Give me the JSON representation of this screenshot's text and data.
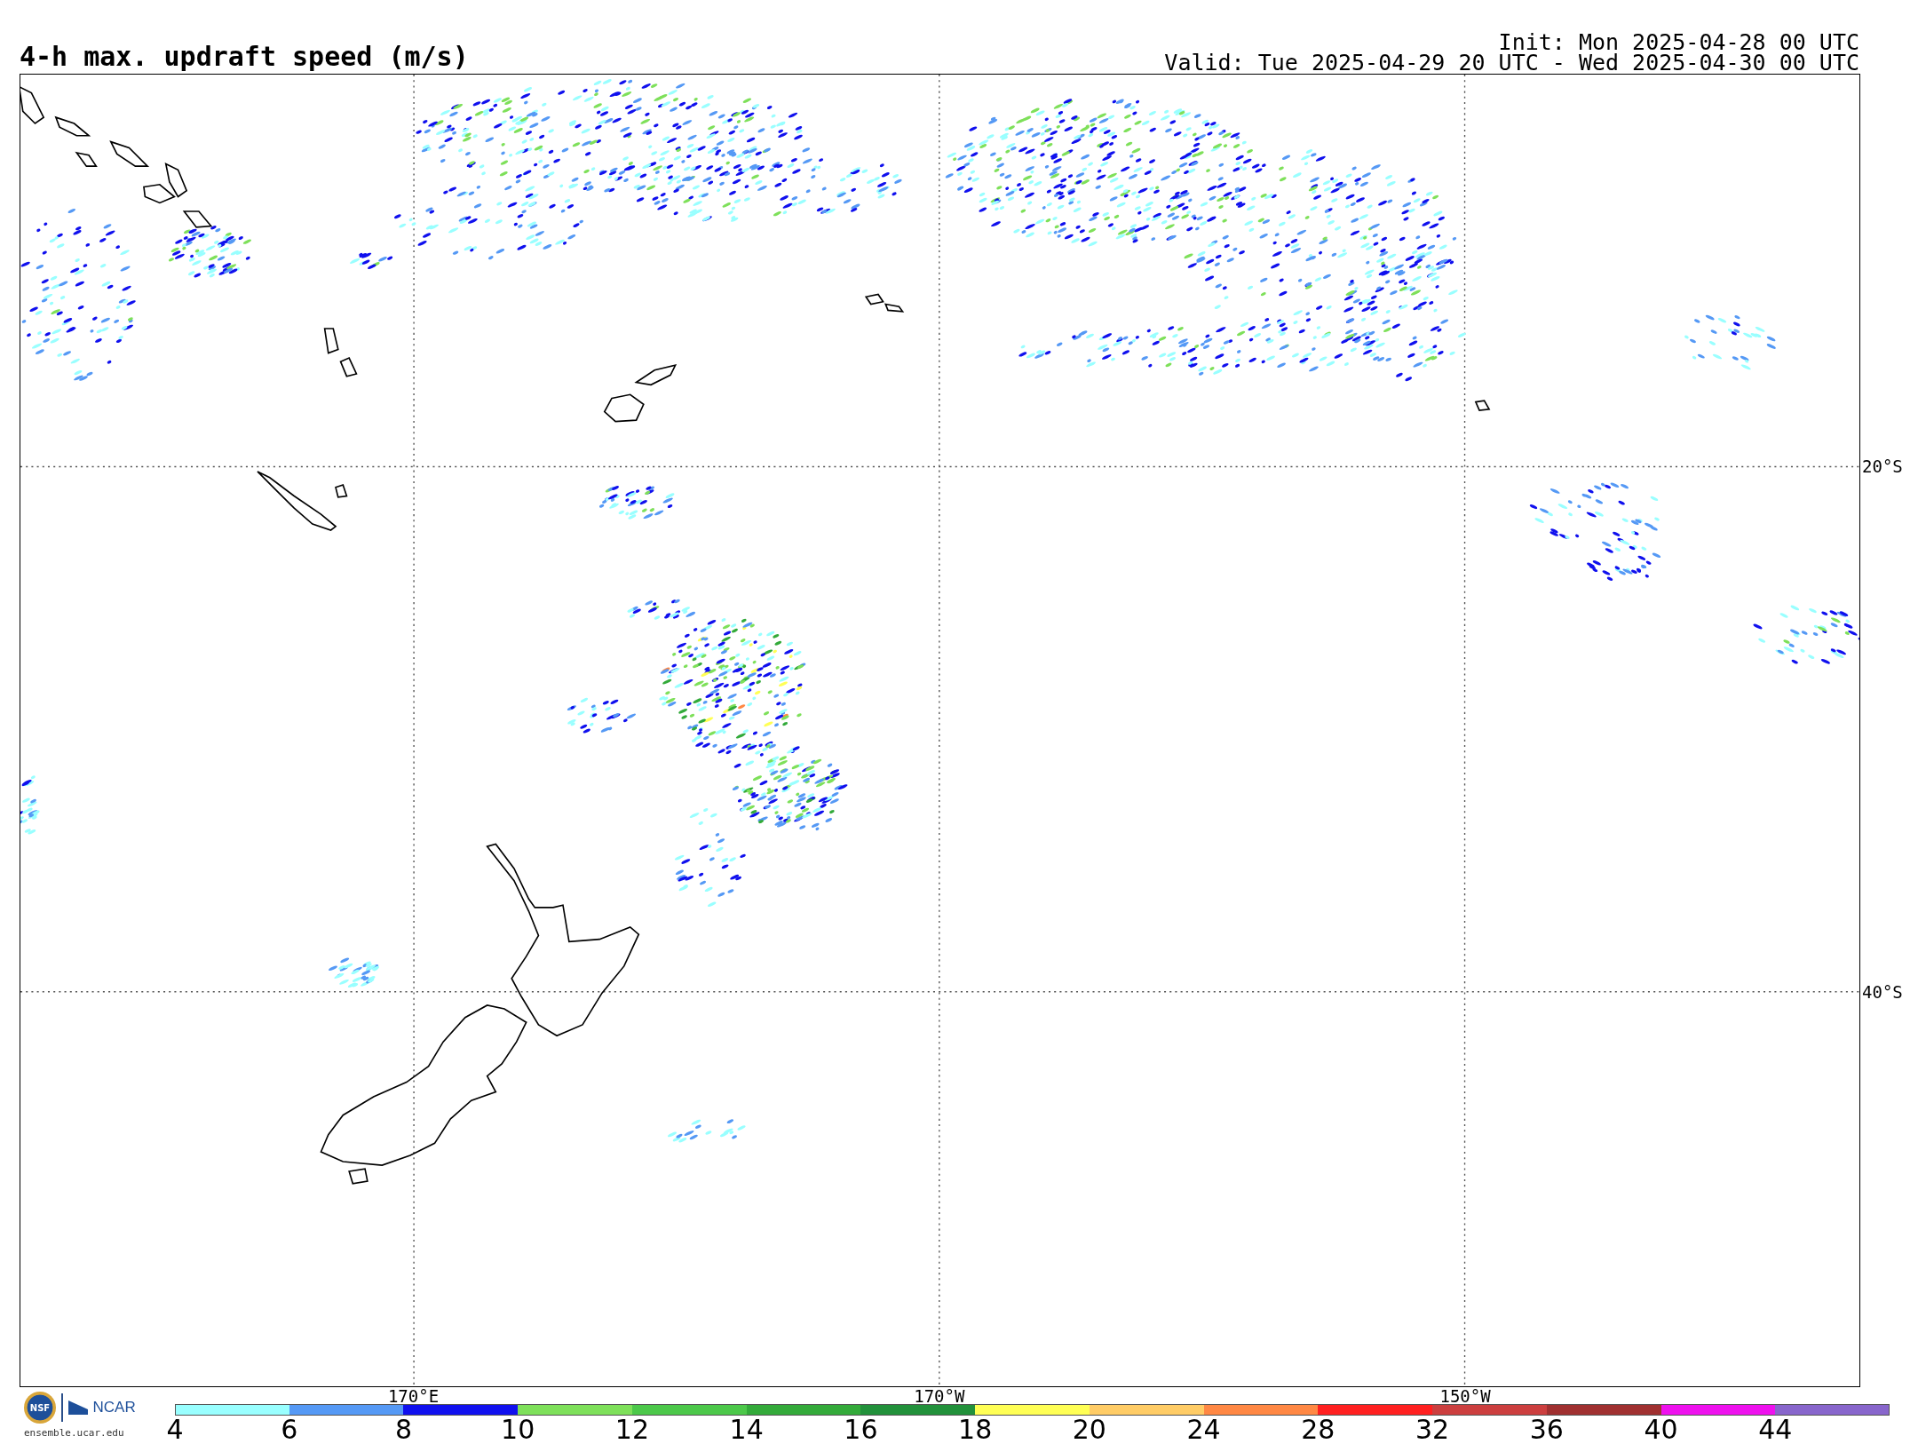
{
  "title": "4-h max. updraft speed (m/s)",
  "init": "Init: Mon 2025-04-28 00 UTC",
  "valid": "Valid: Tue 2025-04-29 20 UTC - Wed 2025-04-30 00 UTC",
  "map": {
    "longitude_labels": [
      "170°E",
      "170°W",
      "150°W"
    ],
    "latitude_labels": [
      "20°S",
      "40°S"
    ]
  },
  "logo": {
    "seal_text": "NSF",
    "name": "NCAR",
    "url": "ensemble.ucar.edu"
  },
  "colorbar": [
    {
      "label": "4",
      "color": "#99ffff"
    },
    {
      "label": "6",
      "color": "#5599f5"
    },
    {
      "label": "8",
      "color": "#1010ee"
    },
    {
      "label": "10",
      "color": "#7ee05a"
    },
    {
      "label": "12",
      "color": "#4cc84a"
    },
    {
      "label": "14",
      "color": "#33aa3a"
    },
    {
      "label": "16",
      "color": "#22913b"
    },
    {
      "label": "18",
      "color": "#ffff55"
    },
    {
      "label": "20",
      "color": "#ffcc66"
    },
    {
      "label": "24",
      "color": "#ff8844"
    },
    {
      "label": "28",
      "color": "#ff2020"
    },
    {
      "label": "32",
      "color": "#cc3f3f"
    },
    {
      "label": "36",
      "color": "#a03030"
    },
    {
      "label": "40",
      "color": "#ee11ee"
    },
    {
      "label": "44",
      "color": "#8866cc"
    }
  ]
}
